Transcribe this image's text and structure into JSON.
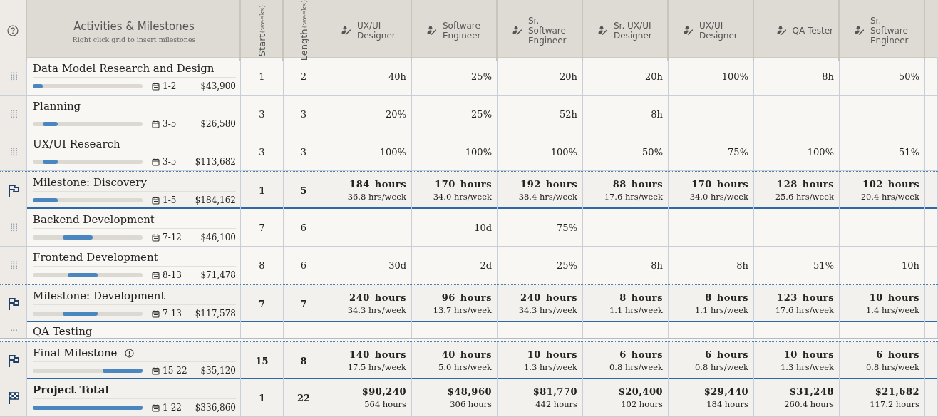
{
  "header": {
    "title": "Activities & Milestones",
    "subtitle": "Right click grid to insert milestones",
    "start_label": "Start",
    "start_unit": "(weeks)",
    "length_label": "Length",
    "length_unit": "(weeks)",
    "roles": [
      "UX/UI Designer",
      "Software Engineer",
      "Sr. Software Engineer",
      "Sr. UX/UI Designer",
      "UX/UI Designer",
      "QA Tester",
      "Sr. Software Engineer"
    ]
  },
  "rows": [
    {
      "kind": "task",
      "name": "Data Model Research and Design",
      "alert": false,
      "start": "1",
      "length": "2",
      "weeks": "1-2",
      "cost": "$43,900",
      "cells": [
        "40h",
        "25%",
        "20h",
        "20h",
        "100%",
        "8h",
        "50%"
      ]
    },
    {
      "kind": "task",
      "name": "Planning",
      "alert": false,
      "start": "3",
      "length": "3",
      "weeks": "3-5",
      "cost": "$26,580",
      "cells": [
        "20%",
        "25%",
        "52h",
        "8h",
        null,
        null,
        null
      ]
    },
    {
      "kind": "task",
      "name": "UX/UI Research",
      "alert": false,
      "start": "3",
      "length": "3",
      "weeks": "3-5",
      "cost": "$113,682",
      "cells": [
        "100%",
        "100%",
        "100%",
        "50%",
        "75%",
        "100%",
        "51%"
      ]
    },
    {
      "kind": "milestone",
      "name": "Milestone: Discovery",
      "alert": false,
      "start": "1",
      "length": "5",
      "weeks": "1-5",
      "cost": "$184,162",
      "cells": [
        {
          "main": "184 hours",
          "sub": "36.8 hrs/week"
        },
        {
          "main": "170 hours",
          "sub": "34.0 hrs/week"
        },
        {
          "main": "192 hours",
          "sub": "38.4 hrs/week"
        },
        {
          "main": "88 hours",
          "sub": "17.6 hrs/week"
        },
        {
          "main": "170 hours",
          "sub": "34.0 hrs/week"
        },
        {
          "main": "128 hours",
          "sub": "25.6 hrs/week"
        },
        {
          "main": "102 hours",
          "sub": "20.4 hrs/week"
        }
      ]
    },
    {
      "kind": "task",
      "name": "Backend Development",
      "alert": false,
      "start": "7",
      "length": "6",
      "weeks": "7-12",
      "cost": "$46,100",
      "cells": [
        null,
        "10d",
        "75%",
        null,
        null,
        null,
        null
      ]
    },
    {
      "kind": "task",
      "name": "Frontend Development",
      "alert": false,
      "start": "8",
      "length": "6",
      "weeks": "8-13",
      "cost": "$71,478",
      "cells": [
        "30d",
        "2d",
        "25%",
        "8h",
        "8h",
        "51%",
        "10h"
      ]
    },
    {
      "kind": "milestone",
      "name": "Milestone: Development",
      "alert": false,
      "start": "7",
      "length": "7",
      "weeks": "7-13",
      "cost": "$117,578",
      "cells": [
        {
          "main": "240 hours",
          "sub": "34.3 hrs/week"
        },
        {
          "main": "96 hours",
          "sub": "13.7 hrs/week"
        },
        {
          "main": "240 hours",
          "sub": "34.3 hrs/week"
        },
        {
          "main": "8 hours",
          "sub": "1.1 hrs/week"
        },
        {
          "main": "8 hours",
          "sub": "1.1 hrs/week"
        },
        {
          "main": "123 hours",
          "sub": "17.6 hrs/week"
        },
        {
          "main": "10 hours",
          "sub": "1.4 hrs/week"
        }
      ]
    }
  ],
  "cut_off_row": {
    "name": "QA Testing"
  },
  "pinned_rows": [
    {
      "kind": "milestone",
      "name": "Final Milestone",
      "alert": true,
      "start": "15",
      "length": "8",
      "weeks": "15-22",
      "cost": "$35,120",
      "cells": [
        {
          "main": "140 hours",
          "sub": "17.5 hrs/week"
        },
        {
          "main": "40 hours",
          "sub": "5.0 hrs/week"
        },
        {
          "main": "10 hours",
          "sub": "1.3 hrs/week"
        },
        {
          "main": "6 hours",
          "sub": "0.8 hrs/week"
        },
        {
          "main": "6 hours",
          "sub": "0.8 hrs/week"
        },
        {
          "main": "10 hours",
          "sub": "1.3 hrs/week"
        },
        {
          "main": "6 hours",
          "sub": "0.8 hrs/week"
        }
      ]
    },
    {
      "kind": "total",
      "name": "Project Total",
      "alert": false,
      "start": "1",
      "length": "22",
      "weeks": "1-22",
      "cost": "$336,860",
      "cells": [
        {
          "main": "$90,240",
          "sub": "564 hours"
        },
        {
          "main": "$48,960",
          "sub": "306 hours"
        },
        {
          "main": "$81,770",
          "sub": "442 hours"
        },
        {
          "main": "$20,400",
          "sub": "102 hours"
        },
        {
          "main": "$29,440",
          "sub": "184 hours"
        },
        {
          "main": "$31,248",
          "sub": "260.4 hours"
        },
        {
          "main": "$21,682",
          "sub": "117.2 hours"
        }
      ]
    }
  ]
}
